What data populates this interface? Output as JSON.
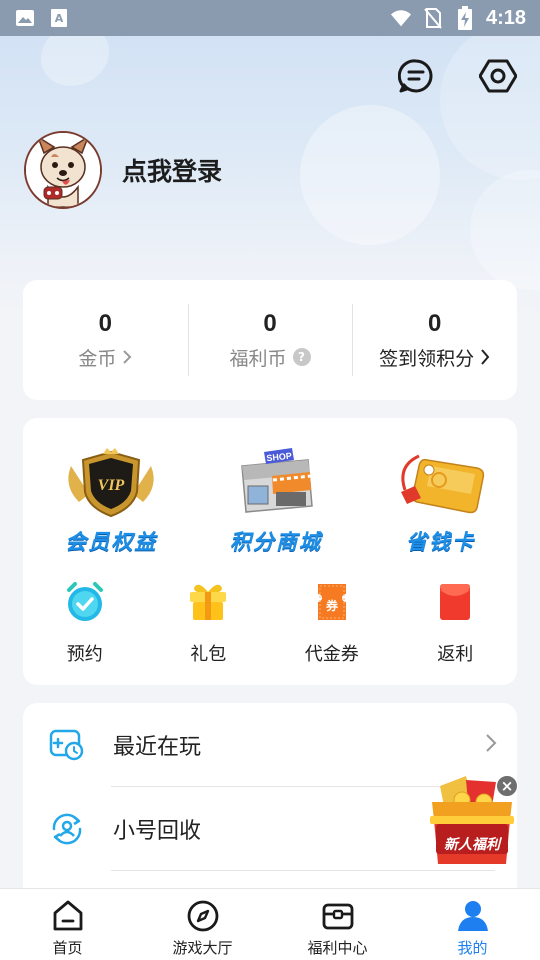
{
  "status_bar": {
    "time": "4:18",
    "icons": [
      "gallery-icon",
      "text-a-icon",
      "wifi-icon",
      "no-sim-icon",
      "battery-charging-icon"
    ]
  },
  "header": {
    "actions": [
      {
        "name": "message-icon"
      },
      {
        "name": "settings-icon"
      }
    ]
  },
  "profile": {
    "login_text": "点我登录",
    "avatar_icon": "dog-avatar-icon"
  },
  "stats": [
    {
      "value": "0",
      "label": "金币",
      "suffix": "chevron"
    },
    {
      "value": "0",
      "label": "福利币",
      "suffix": "help"
    },
    {
      "value": "0",
      "label": "签到领积分",
      "suffix": "chevron"
    }
  ],
  "features": {
    "big": [
      {
        "label": "会员权益",
        "icon": "vip-badge-icon"
      },
      {
        "label": "积分商城",
        "icon": "shop-icon"
      },
      {
        "label": "省钱卡",
        "icon": "gold-card-icon"
      }
    ],
    "small": [
      {
        "label": "预约",
        "icon": "alarm-clock-icon"
      },
      {
        "label": "礼包",
        "icon": "gift-icon"
      },
      {
        "label": "代金券",
        "icon": "coupon-icon"
      },
      {
        "label": "返利",
        "icon": "red-envelope-icon"
      }
    ],
    "coupon_glyph": "券"
  },
  "list": [
    {
      "label": "最近在玩",
      "icon": "recent-play-icon"
    },
    {
      "label": "小号回收",
      "icon": "account-recycle-icon"
    }
  ],
  "promo": {
    "label": "新人福利",
    "close": "×"
  },
  "bottom_nav": [
    {
      "label": "首页",
      "icon": "home-icon",
      "active": false
    },
    {
      "label": "游戏大厅",
      "icon": "compass-icon",
      "active": false
    },
    {
      "label": "福利中心",
      "icon": "chest-icon",
      "active": false
    },
    {
      "label": "我的",
      "icon": "user-icon",
      "active": true
    }
  ],
  "colors": {
    "accent": "#1e7ff0",
    "label_blue": "#1e8fe6",
    "icon_cyan": "#2aa8e8",
    "promo_red": "#e0312b"
  }
}
